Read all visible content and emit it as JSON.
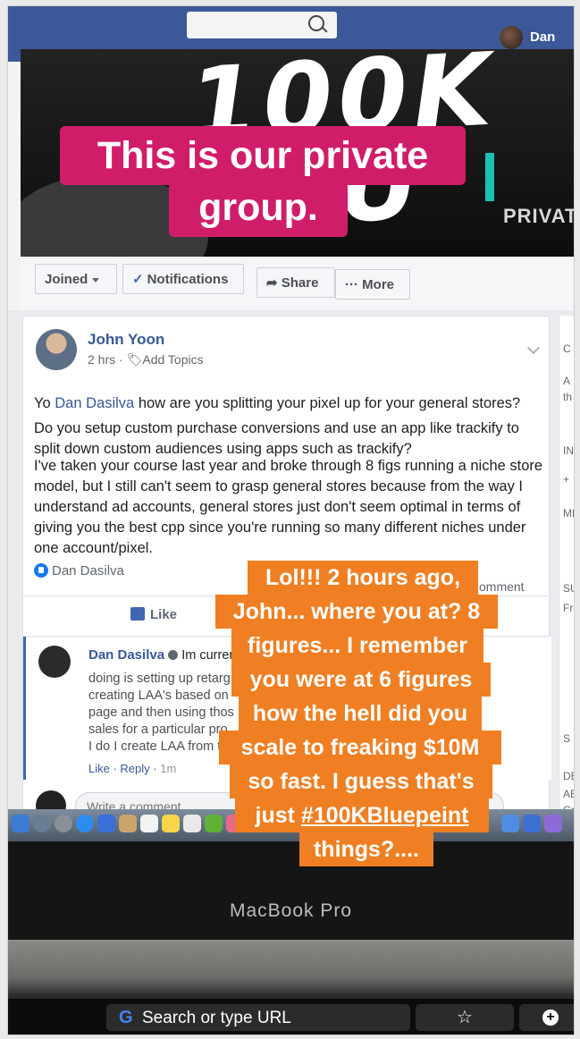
{
  "topbar": {
    "user_name": "Dan"
  },
  "cover": {
    "script_text": "100K BLU",
    "subtitle": "PRIVATE M"
  },
  "group_actions": {
    "joined": "Joined",
    "notifications": "Notifications",
    "share": "Share",
    "more": "More"
  },
  "post": {
    "author": "John Yoon",
    "time": "2 hrs",
    "add_topics": "Add Topics",
    "line1_prefix": "Yo ",
    "line1_mention": "Dan Dasilva",
    "line1_suffix": " how are you splitting your pixel up for your general stores?",
    "para2": "Do you setup custom purchase conversions and use an app like trackify to split down custom audiences using apps such as trackify?",
    "para3": "I've taken your course last year and broke through 8 figs running a niche store model, but I still can't seem to grasp general stores because from the way I understand ad accounts, general stores just don't seem optimal in terms of giving you the best cpp since you're running so many different niches under one account/pixel.",
    "reaction_name": "Dan Dasilva",
    "comment_count": "omment",
    "like_label": "Like"
  },
  "comment": {
    "author": "Dan Dasilva",
    "lines": [
      "Im curren",
      "doing is setting up retarg",
      "creating LAA's based on",
      "page and then using thos",
      "sales for a particular pro",
      "I do I create LAA from t"
    ],
    "like": "Like",
    "reply": "Reply",
    "time": "1m"
  },
  "write_comment": {
    "placeholder": "Write a comment..."
  },
  "right_column": [
    "C",
    "A",
    "th",
    "IN",
    "+",
    "ME",
    "SUG",
    "Frien",
    "S",
    "DESCR",
    "ABC R",
    "Group"
  ],
  "laptop": {
    "brand": "MacBook Pro"
  },
  "touchbar": {
    "search_text": "Search or type URL",
    "star": "☆",
    "plus": "+"
  },
  "overlay_pink": {
    "line1": "This is our private",
    "line2": "group."
  },
  "overlay_orange": {
    "lines": [
      "Lol!!! 2 hours ago,",
      "John... where you at? 8",
      "figures... I remember",
      "you were at 6 figures",
      "how the hell did you",
      "scale to freaking $10M",
      "so fast. I guess that's"
    ],
    "line8_prefix": "just ",
    "line8_hashtag": "#100KBluepeint",
    "line9": "things?...."
  },
  "colors": {
    "facebook_blue": "#3b5998",
    "caption_pink": "#d01d6a",
    "caption_orange": "#ef7f22"
  }
}
